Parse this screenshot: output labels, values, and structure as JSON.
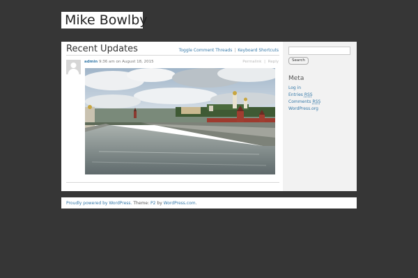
{
  "site": {
    "title": "Mike Bowlby"
  },
  "main": {
    "title": "Recent Updates",
    "header_links": [
      "Toggle Comment Threads",
      "Keyboard Shortcuts"
    ],
    "header_sep": "|"
  },
  "post": {
    "author": "admin",
    "time": "9:36 am",
    "on_word": "on",
    "date": "August 18, 2015",
    "actions": [
      "Permalink",
      "Reply"
    ],
    "actions_sep": "|"
  },
  "sidebar": {
    "search_button": "Search",
    "meta_title": "Meta",
    "meta_items": {
      "login": "Log in",
      "entries_word": "Entries",
      "entries_abbr": "RSS",
      "comments_word": "Comments",
      "comments_abbr": "RSS",
      "wordpress": "WordPress.org"
    }
  },
  "footer": {
    "powered": "Proudly powered by WordPress.",
    "theme_word": "Theme:",
    "theme_name": "P2",
    "by_word": "by",
    "theme_author": "WordPress.com",
    "period": "."
  },
  "colors": {
    "page_bg": "#363636",
    "link": "#3478a8",
    "sidebar_bg": "#f2f2f2"
  },
  "icons": {
    "avatar": "default-avatar-icon"
  }
}
